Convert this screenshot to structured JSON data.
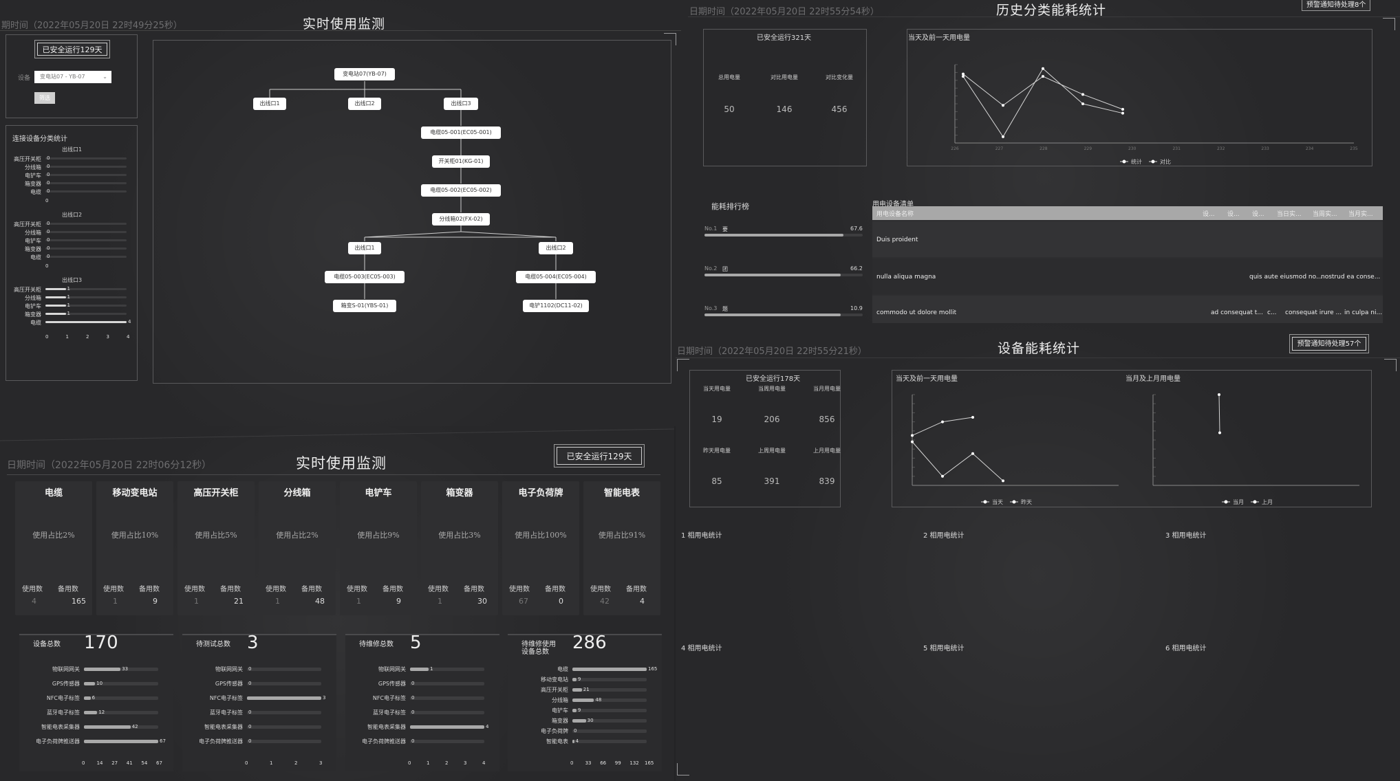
{
  "q1": {
    "timestamp": "期时间（2022年05月20日 22时49分25秒）",
    "title": "实时使用监测",
    "safe_btn": "已安全运行129天",
    "device_label": "设备",
    "device_select": "变电站07 - YB-07",
    "filter_btn": "筛选",
    "cat_title": "连接设备分类统计",
    "groups": [
      {
        "name": "出线口1",
        "rows": [
          {
            "l": "高压开关柜",
            "v": "0"
          },
          {
            "l": "分线箱",
            "v": "0"
          },
          {
            "l": "电铲车",
            "v": "0"
          },
          {
            "l": "箱变器",
            "v": "0"
          },
          {
            "l": "电缆",
            "v": "0"
          }
        ]
      },
      {
        "name": "出线口2",
        "rows": [
          {
            "l": "高压开关柜",
            "v": "0"
          },
          {
            "l": "分线箱",
            "v": "0"
          },
          {
            "l": "电铲车",
            "v": "0"
          },
          {
            "l": "箱变器",
            "v": "0"
          },
          {
            "l": "电缆",
            "v": "0"
          }
        ]
      },
      {
        "name": "出线口3",
        "rows": [
          {
            "l": "高压开关柜",
            "v": "1"
          },
          {
            "l": "分线箱",
            "v": "1"
          },
          {
            "l": "电铲车",
            "v": "1"
          },
          {
            "l": "箱变器",
            "v": "1"
          },
          {
            "l": "电缆",
            "v": "4"
          }
        ]
      }
    ],
    "axis0": "0",
    "axis_ticks": [
      "0",
      "1",
      "2",
      "3",
      "4"
    ],
    "tree": {
      "root": "变电站07(YB-07)",
      "out1": "出线口1",
      "out2": "出线口2",
      "out3": "出线口3",
      "c1": "电缆05-001(EC05-001)",
      "k1": "开关柜01(KG-01)",
      "c2": "电缆05-002(EC05-002)",
      "fx": "分线箱02(FX-02)",
      "o1": "出线口1",
      "o2": "出线口2",
      "c3": "电缆05-003(EC05-003)",
      "c4": "电缆05-004(EC05-004)",
      "xb": "箱变S-01(YBS-01)",
      "dc": "电铲1102(DC11-02)"
    }
  },
  "q2": {
    "timestamp": "日期时间（2022年05月20日 22时55分54秒）",
    "title": "历史分类能耗统计",
    "alert": "预警通知待处理8个",
    "safe": "已安全运行321天",
    "gauges": [
      {
        "label": "总用电量",
        "value": "50"
      },
      {
        "label": "对比用电量",
        "value": "146"
      },
      {
        "label": "对比变化量",
        "value": "456"
      }
    ],
    "chart_title": "当天及前一天用电量",
    "legend": [
      "统计",
      "对比"
    ],
    "rank_title": "能耗排行榜",
    "rank": [
      {
        "no": "No.1",
        "name": "要",
        "value": "67.6",
        "pct": 1.0
      },
      {
        "no": "No.2",
        "name": "团",
        "value": "66.2",
        "pct": 0.98
      },
      {
        "no": "No.3",
        "name": "题",
        "value": "10.9",
        "pct": 0.98
      }
    ],
    "table_title": "用电设备清单",
    "table_head": [
      "用电设备名称",
      "设...",
      "设...",
      "设...",
      "当日实...",
      "当周实...",
      "当月实..."
    ],
    "table_rows": [
      {
        "c0": "Duis proident",
        "c4": "",
        "c5": "",
        "c6": ""
      },
      {
        "c0": "nulla aliqua magna",
        "c4": "quis aute eiusmod no...",
        "c5": "nostrud ea conse...",
        "c6": ""
      },
      {
        "c0": "commodo ut dolore mollit",
        "c1": "ad consequat t...",
        "c2": "c...",
        "c3": "consequat irure ...",
        "c4": "in culpa ni..."
      }
    ]
  },
  "q3": {
    "timestamp": "日期时间（2022年05月20日 22时06分12秒）",
    "title": "实时使用监测",
    "safe_btn": "已安全运行129天",
    "devices": [
      {
        "name": "电缆",
        "pct_label": "使用占比2%",
        "pct": 0.02,
        "used": "4",
        "spare": "165"
      },
      {
        "name": "移动变电站",
        "pct_label": "使用占比10%",
        "pct": 0.1,
        "used": "1",
        "spare": "9"
      },
      {
        "name": "高压开关柜",
        "pct_label": "使用占比5%",
        "pct": 0.05,
        "used": "1",
        "spare": "21"
      },
      {
        "name": "分线箱",
        "pct_label": "使用占比2%",
        "pct": 0.02,
        "used": "1",
        "spare": "48"
      },
      {
        "name": "电铲车",
        "pct_label": "使用占比9%",
        "pct": 0.09,
        "used": "1",
        "spare": "9"
      },
      {
        "name": "箱变器",
        "pct_label": "使用占比3%",
        "pct": 0.03,
        "used": "1",
        "spare": "30"
      },
      {
        "name": "电子负荷牌",
        "pct_label": "使用占比100%",
        "pct": 1.0,
        "used": "67",
        "spare": "0"
      },
      {
        "name": "智能电表",
        "pct_label": "使用占比91%",
        "pct": 0.91,
        "used": "42",
        "spare": "4"
      }
    ],
    "used_label": "使用数",
    "spare_label": "备用数",
    "sum_cards": [
      {
        "label": "设备总数",
        "value": "170",
        "rows": [
          {
            "l": "物联网网关",
            "v": "33"
          },
          {
            "l": "GPS传感器",
            "v": "10"
          },
          {
            "l": "NFC电子标签",
            "v": "6"
          },
          {
            "l": "蓝牙电子标签",
            "v": "12"
          },
          {
            "l": "智能电表采集器",
            "v": "42"
          },
          {
            "l": "电子负荷牌推送器",
            "v": "67"
          }
        ],
        "max": 67,
        "ticks": [
          "0",
          "14",
          "27",
          "41",
          "54",
          "67"
        ]
      },
      {
        "label": "待测试总数",
        "value": "3",
        "rows": [
          {
            "l": "物联网网关",
            "v": "0"
          },
          {
            "l": "GPS传感器",
            "v": "0"
          },
          {
            "l": "NFC电子标签",
            "v": "3"
          },
          {
            "l": "蓝牙电子标签",
            "v": "0"
          },
          {
            "l": "智能电表采集器",
            "v": "0"
          },
          {
            "l": "电子负荷牌推送器",
            "v": "0"
          }
        ],
        "max": 3,
        "ticks": [
          "0",
          "1",
          "2",
          "3"
        ]
      },
      {
        "label": "待维修总数",
        "value": "5",
        "rows": [
          {
            "l": "物联网网关",
            "v": "1"
          },
          {
            "l": "GPS传感器",
            "v": "0"
          },
          {
            "l": "NFC电子标签",
            "v": "0"
          },
          {
            "l": "蓝牙电子标签",
            "v": "0"
          },
          {
            "l": "智能电表采集器",
            "v": "4"
          },
          {
            "l": "电子负荷牌推送器",
            "v": "0"
          }
        ],
        "max": 4,
        "ticks": [
          "0",
          "1",
          "2",
          "3",
          "4"
        ]
      },
      {
        "label": "待维修使用设备总数",
        "value": "286",
        "rows": [
          {
            "l": "电缆",
            "v": "165"
          },
          {
            "l": "移动变电站",
            "v": "9"
          },
          {
            "l": "高压开关柜",
            "v": "21"
          },
          {
            "l": "分线箱",
            "v": "48"
          },
          {
            "l": "电铲车",
            "v": "9"
          },
          {
            "l": "箱变器",
            "v": "30"
          },
          {
            "l": "电子负荷牌",
            "v": "0"
          },
          {
            "l": "智能电表",
            "v": "4"
          }
        ],
        "max": 165,
        "ticks": [
          "0",
          "33",
          "66",
          "99",
          "132",
          "165"
        ]
      }
    ]
  },
  "q4": {
    "timestamp": "日期时间（2022年05月20日 22时55分21秒）",
    "title": "设备能耗统计",
    "alert": "预警通知待处理57个",
    "safe": "已安全运行178天",
    "gauges": [
      {
        "label": "当天用电量",
        "value": "19"
      },
      {
        "label": "当周用电量",
        "value": "206"
      },
      {
        "label": "当月用电量",
        "value": "856"
      },
      {
        "label": "昨天用电量",
        "value": "85"
      },
      {
        "label": "上周用电量",
        "value": "391"
      },
      {
        "label": "上月用电量",
        "value": "839"
      }
    ],
    "chart1_title": "当天及前一天用电量",
    "chart2_title": "当月及上月用电量",
    "legend_day": [
      "当天",
      "昨天"
    ],
    "legend_month": [
      "当月",
      "上月"
    ],
    "phase_titles": [
      "1 相用电统计",
      "2 相用电统计",
      "3 相用电统计",
      "4 相用电统计",
      "5 相用电统计",
      "6 相用电统计"
    ]
  },
  "chart_data": [
    {
      "type": "line",
      "title": "当天及前一天用电量",
      "x": [
        "226",
        "227",
        "228",
        "229",
        "230",
        "231",
        "232",
        "233",
        "234",
        "235"
      ],
      "series": [
        {
          "name": "统计",
          "values": [
            88,
            48,
            85,
            62,
            43
          ]
        },
        {
          "name": "对比",
          "values": [
            85,
            8,
            95,
            50,
            38
          ]
        }
      ],
      "ylim": [
        0,
        100
      ]
    },
    {
      "type": "line",
      "title": "当天及前一天用电量",
      "series": [
        {
          "name": "当天",
          "values": [
            55,
            70,
            75
          ]
        },
        {
          "name": "昨天",
          "values": [
            48,
            10,
            35,
            5
          ]
        }
      ],
      "ylim": [
        0,
        100
      ]
    },
    {
      "type": "line",
      "title": "当月及上月用电量",
      "series": [
        {
          "name": "当月",
          "values": [
            100,
            58
          ]
        }
      ],
      "ylim": [
        0,
        100
      ]
    },
    {
      "type": "line",
      "title": "1 相用电统计",
      "series": [
        {
          "name": "当天",
          "values": [
            80,
            10,
            90,
            30,
            45
          ]
        },
        {
          "name": "昨天",
          "values": [
            75,
            45,
            60,
            90,
            40
          ]
        }
      ],
      "ylim": [
        0,
        100
      ]
    },
    {
      "type": "line",
      "title": "2 相用电统计",
      "series": [
        {
          "name": "当天",
          "values": [
            55,
            90,
            70
          ]
        },
        {
          "name": "昨天",
          "values": [
            10,
            18
          ]
        }
      ],
      "ylim": [
        0,
        100
      ]
    },
    {
      "type": "line",
      "title": "3 相用电统计",
      "series": [
        {
          "name": "当天",
          "values": [
            78,
            35,
            33
          ]
        }
      ],
      "ylim": [
        0,
        100
      ]
    }
  ]
}
